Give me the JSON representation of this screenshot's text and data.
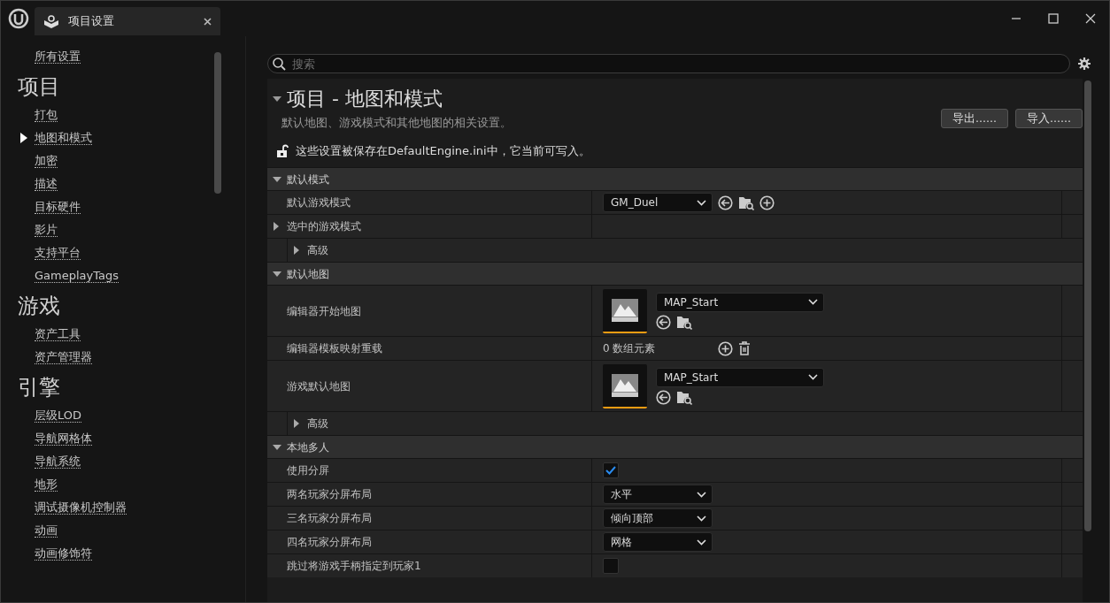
{
  "window": {
    "tab_title": "项目设置"
  },
  "sidebar": [
    {
      "kind": "link",
      "label": "所有设置",
      "selected": false
    },
    {
      "kind": "heading",
      "label": "项目"
    },
    {
      "kind": "link",
      "label": "打包",
      "selected": false
    },
    {
      "kind": "link",
      "label": "地图和模式",
      "selected": true
    },
    {
      "kind": "link",
      "label": "加密",
      "selected": false
    },
    {
      "kind": "link",
      "label": "描述",
      "selected": false
    },
    {
      "kind": "link",
      "label": "目标硬件",
      "selected": false
    },
    {
      "kind": "link",
      "label": "影片",
      "selected": false
    },
    {
      "kind": "link",
      "label": "支持平台",
      "selected": false
    },
    {
      "kind": "link",
      "label": "GameplayTags",
      "selected": false
    },
    {
      "kind": "heading",
      "label": "游戏"
    },
    {
      "kind": "link",
      "label": "资产工具",
      "selected": false
    },
    {
      "kind": "link",
      "label": "资产管理器",
      "selected": false
    },
    {
      "kind": "heading",
      "label": "引擎"
    },
    {
      "kind": "link",
      "label": "层级LOD",
      "selected": false
    },
    {
      "kind": "link",
      "label": "导航网格体",
      "selected": false
    },
    {
      "kind": "link",
      "label": "导航系统",
      "selected": false
    },
    {
      "kind": "link",
      "label": "地形",
      "selected": false
    },
    {
      "kind": "link",
      "label": "调试摄像机控制器",
      "selected": false
    },
    {
      "kind": "link",
      "label": "动画",
      "selected": false
    },
    {
      "kind": "link",
      "label": "动画修饰符",
      "selected": false
    }
  ],
  "search": {
    "placeholder": "搜索"
  },
  "page": {
    "title": "项目 - 地图和模式",
    "description": "默认地图、游戏模式和其他地图的相关设置。",
    "buttons": [
      "导出......",
      "导入......"
    ],
    "notice": "这些设置被保存在DefaultEngine.ini中，它当前可写入。"
  },
  "sections": [
    {
      "title": "默认模式",
      "expanded": true,
      "rows": [
        {
          "kind": "class",
          "label": "默认游戏模式",
          "value": "GM_Duel"
        },
        {
          "kind": "expandable",
          "label": "选中的游戏模式",
          "expanded": false
        },
        {
          "kind": "subgroup",
          "label": "高级",
          "expanded": false
        }
      ]
    },
    {
      "title": "默认地图",
      "expanded": true,
      "rows": [
        {
          "kind": "asset",
          "label": "编辑器开始地图",
          "value": "MAP_Start"
        },
        {
          "kind": "array",
          "label": "编辑器模板映射重载",
          "value": "0 数组元素"
        },
        {
          "kind": "asset",
          "label": "游戏默认地图",
          "value": "MAP_Start"
        },
        {
          "kind": "subgroup",
          "label": "高级",
          "expanded": false
        }
      ]
    },
    {
      "title": "本地多人",
      "expanded": true,
      "rows": [
        {
          "kind": "checkbox",
          "label": "使用分屏",
          "checked": true
        },
        {
          "kind": "dropdown",
          "label": "两名玩家分屏布局",
          "value": "水平"
        },
        {
          "kind": "dropdown",
          "label": "三名玩家分屏布局",
          "value": "倾向顶部"
        },
        {
          "kind": "dropdown",
          "label": "四名玩家分屏布局",
          "value": "网格"
        },
        {
          "kind": "checkbox",
          "label": "跳过将游戏手柄指定到玩家1",
          "checked": false
        }
      ]
    }
  ]
}
